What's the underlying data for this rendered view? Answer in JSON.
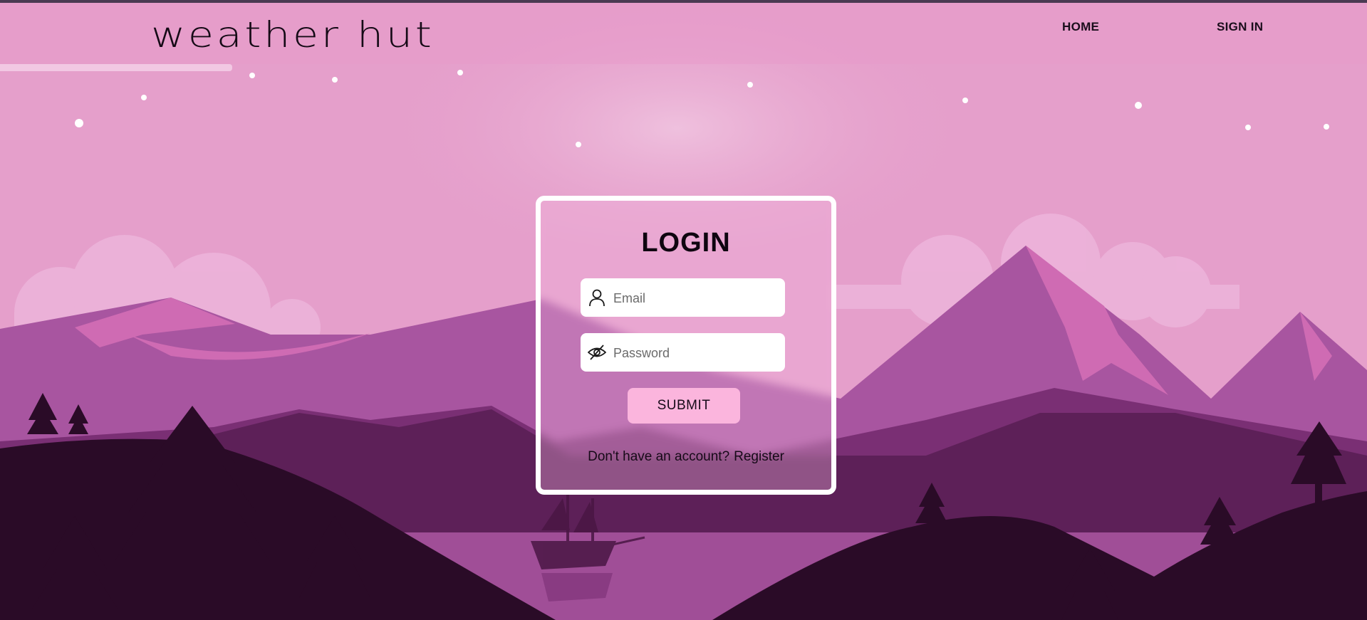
{
  "app": {
    "logo_text": "weather hut"
  },
  "nav": {
    "home": "HOME",
    "sign_in": "SIGN IN"
  },
  "login": {
    "title": "LOGIN",
    "email_placeholder": "Email",
    "password_placeholder": "Password",
    "submit_label": "SUBMIT",
    "no_account_text": "Don't have an account?",
    "register_link": "Register"
  },
  "icons": {
    "email": "user-icon",
    "password": "eye-slash-icon"
  },
  "colors": {
    "sky": "#e59fcb",
    "card_border": "#ffffff",
    "submit_bg": "#fbb5dd",
    "mountain_far": "#a855a0",
    "forest": "#2a0b27"
  }
}
